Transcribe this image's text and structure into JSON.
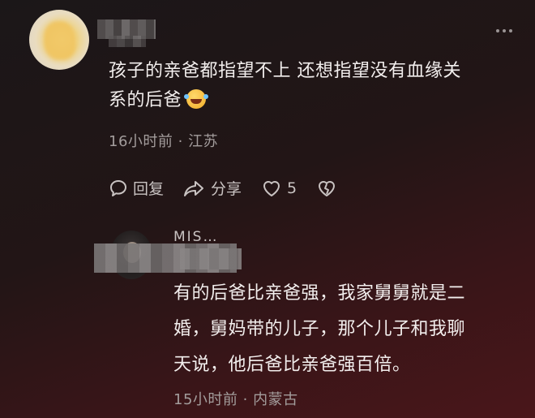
{
  "comment": {
    "text_line1": "孩子的亲爸都指望不上 还想指望没有血缘关",
    "text_line2": "系的后爸",
    "meta": "16小时前 · 江苏",
    "actions": {
      "reply_label": "回复",
      "share_label": "分享",
      "like_count": "5"
    }
  },
  "reply": {
    "name": "MIS…",
    "text_line1": "有的后爸比亲爸强，我家舅舅就是二",
    "text_line2": "婚，舅妈带的儿子，那个儿子和我聊",
    "text_line3": "天说，他后爸比亲爸强百倍。",
    "meta": "15小时前 · 内蒙古"
  },
  "icons": {
    "reply": "comment-bubble-icon",
    "share": "share-arrow-icon",
    "like": "heart-icon",
    "dislike": "broken-heart-icon",
    "more": "more-dots-icon",
    "emoji": "rolling-laughing-emoji"
  }
}
